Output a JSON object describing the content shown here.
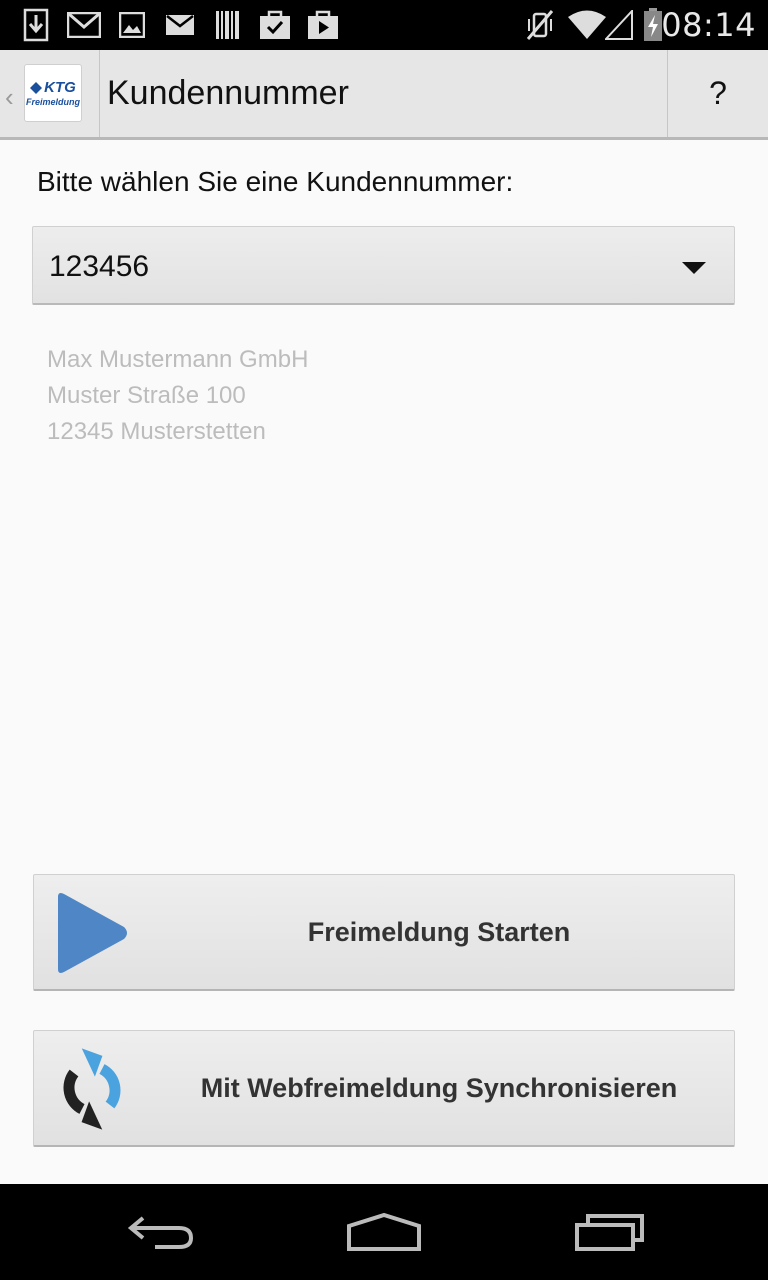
{
  "status_bar": {
    "time": "08:14",
    "left_icons": [
      "download-icon",
      "gmail-icon",
      "image-icon",
      "email-icon",
      "barcode-icon",
      "task-check-icon",
      "play-store-icon"
    ],
    "right_icons": [
      "vibrate-off-icon",
      "wifi-icon",
      "signal-icon",
      "battery-charging-icon"
    ]
  },
  "action_bar": {
    "logo_text": "KTG",
    "logo_subtext": "Freimeldung",
    "title": "Kundennummer",
    "help_label": "?"
  },
  "content": {
    "prompt": "Bitte wählen Sie eine Kundennummer:",
    "customer_number": "123456",
    "address": {
      "line1": "Max Mustermann GmbH",
      "line2": "Muster Straße 100",
      "line3": "12345 Musterstetten"
    }
  },
  "buttons": {
    "start_label": "Freimeldung Starten",
    "sync_label": "Mit Webfreimeldung Synchronisieren"
  },
  "colors": {
    "accent_blue": "#4f86c6",
    "sync_dark": "#222222",
    "sync_blue": "#4aa3df"
  },
  "nav_bar": {
    "icons": [
      "back-icon",
      "home-icon",
      "recent-apps-icon"
    ]
  }
}
